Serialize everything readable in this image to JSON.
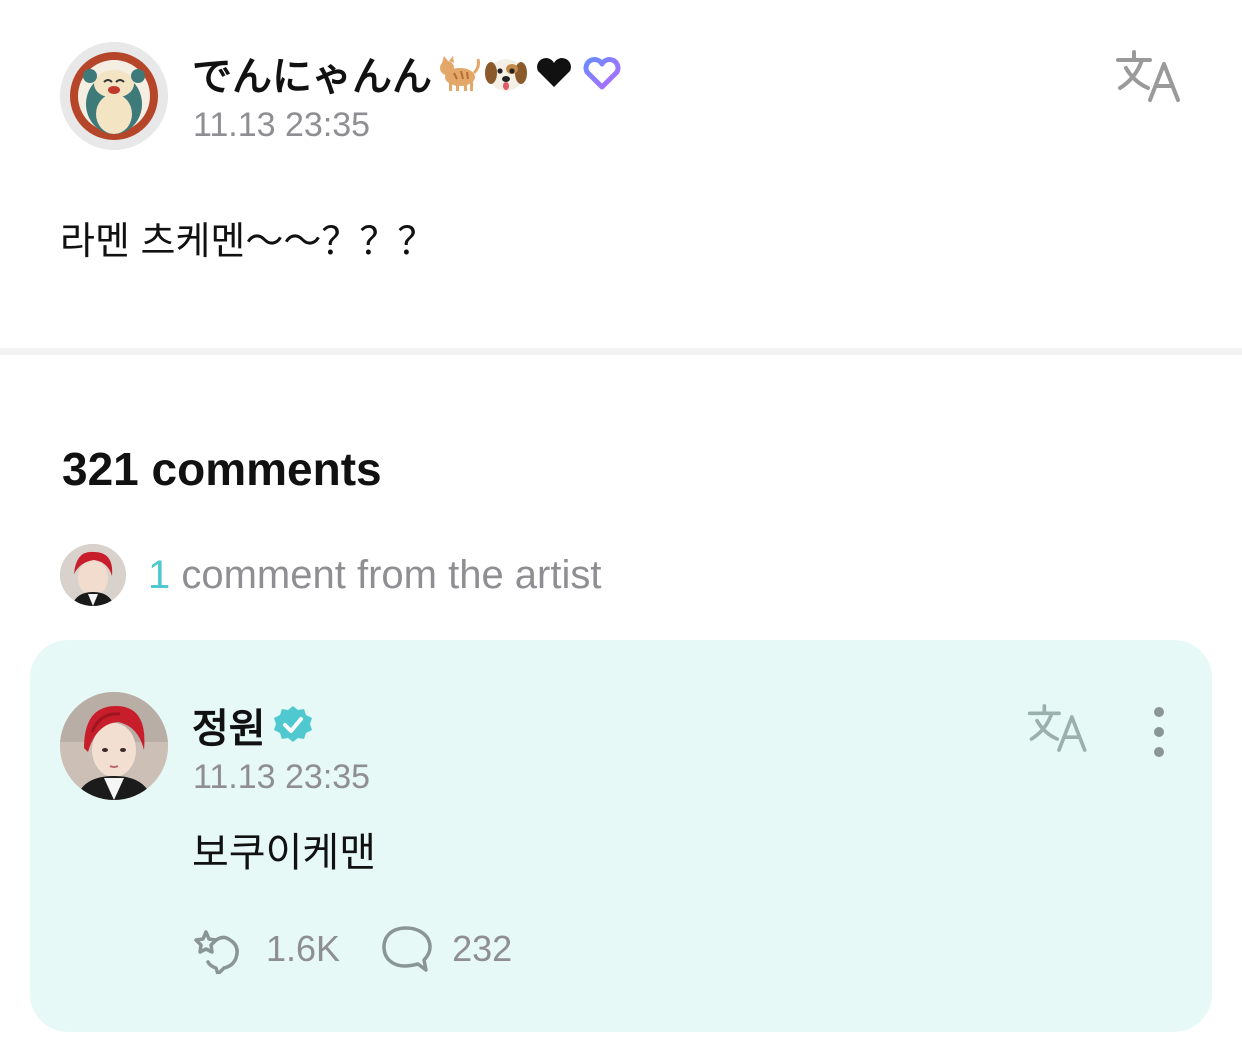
{
  "post": {
    "author": "でんにゃんん",
    "author_emojis": [
      "cat-emoji",
      "dog-face-emoji",
      "black-heart-emoji",
      "purple-heart-outline-emoji"
    ],
    "timestamp": "11.13 23:35",
    "body": "라멘 츠케멘～～？？？"
  },
  "comments": {
    "count_label": "321 comments",
    "artist_summary": {
      "count": "1",
      "label": " comment from the artist"
    }
  },
  "artist_comment": {
    "author": "정원",
    "timestamp": "11.13 23:35",
    "body": "보쿠이케맨",
    "likes": "1.6K",
    "replies": "232"
  },
  "colors": {
    "accent": "#4fc9cf",
    "card_bg": "#e7f9f7",
    "muted": "#8e8e93"
  }
}
